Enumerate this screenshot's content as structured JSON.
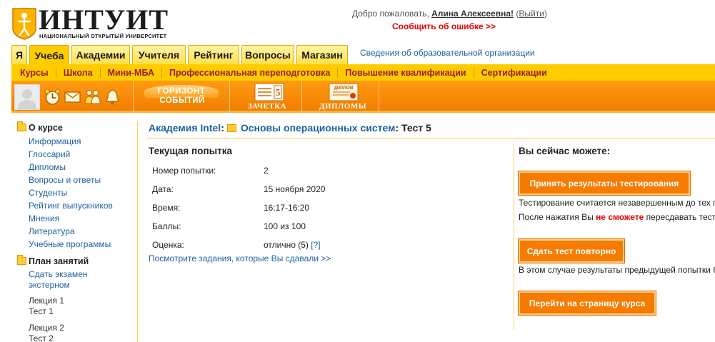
{
  "logo": {
    "word": "ИНТУИТ",
    "subtitle": "НАЦИОНАЛЬНЫЙ ОТКРЫТЫЙ УНИВЕРСИТЕТ"
  },
  "header": {
    "welcome_prefix": "Добро пожаловать,",
    "user_name": "Алина Алексеевна!",
    "logout_open": "(",
    "logout_label": "Выйти",
    "logout_close": ")",
    "report_error": "Сообщить об ошибке >>"
  },
  "tabs": [
    {
      "label": "Я",
      "active": false
    },
    {
      "label": "Учеба",
      "active": true
    },
    {
      "label": "Академии",
      "active": false
    },
    {
      "label": "Учителя",
      "active": false
    },
    {
      "label": "Рейтинг",
      "active": false
    },
    {
      "label": "Вопросы",
      "active": false
    },
    {
      "label": "Магазин",
      "active": false
    }
  ],
  "edu_info_link": "Сведения об образовательной организации",
  "submenu": [
    "Курсы",
    "Школа",
    "Мини-МБА",
    "Профессиональная переподготовка",
    "Повышение квалификации",
    "Сертификации"
  ],
  "toolbar": {
    "icons": [
      "avatar",
      "alarm-clock-icon",
      "envelope-icon",
      "people-icon",
      "bell-icon"
    ],
    "horizon_top": "ГОРИЗОНТ",
    "horizon_bottom": "СОБЫТИЙ",
    "gradebook_label": "ЗАЧЕТКА",
    "gradebook_mark": "5",
    "diplomas_label": "ДИПЛОМЫ",
    "diploma_card_text": "ДИПЛОМ",
    "accent_color": "#f28a00"
  },
  "sidebar": {
    "about_title": "О курсе",
    "about_links": [
      "Информация",
      "Глоссарий",
      "Дипломы",
      "Вопросы и ответы",
      "Студенты",
      "Рейтинг выпускников",
      "Мнения",
      "Литература",
      "Учебные программы"
    ],
    "plan_title": "План занятий",
    "plan_exam": [
      "Сдать экзамен",
      "экстерном"
    ],
    "lectures": [
      {
        "lecture": "Лекция 1",
        "test": "Тест 1"
      },
      {
        "lecture": "Лекция 2",
        "test": "Тест 2"
      }
    ]
  },
  "breadcrumb": {
    "academy": "Академия Intel",
    "sep1": ":",
    "course": "Основы операционных систем",
    "sep2": ":",
    "current": "Тест 5"
  },
  "attempt": {
    "title": "Текущая попытка",
    "rows": [
      {
        "key": "Номер попытки:",
        "value": "2"
      },
      {
        "key": "Дата:",
        "value": "15 ноября 2020"
      },
      {
        "key": "Время:",
        "value": "16:17-16:20"
      },
      {
        "key": "Баллы:",
        "value": "100 из 100"
      },
      {
        "key": "Оценка:",
        "value": "отлично (5)",
        "help": "[?]"
      }
    ],
    "tasks_link": "Посмотрите задания, которые Вы сдавали >>"
  },
  "actions": {
    "title": "Вы сейчас можете:",
    "accept_button": "Принять результаты тестирования",
    "accept_note": "Тестирование считается незавершенным до тех п",
    "after_prefix": "После нажатия Вы",
    "after_warn": "не сможете",
    "after_suffix": "пересдавать тест",
    "retake_button": "Сдать тест повторно",
    "retake_note": "В этом случае результаты предыдущей попытки б",
    "course_button": "Перейти на страницу курса"
  }
}
